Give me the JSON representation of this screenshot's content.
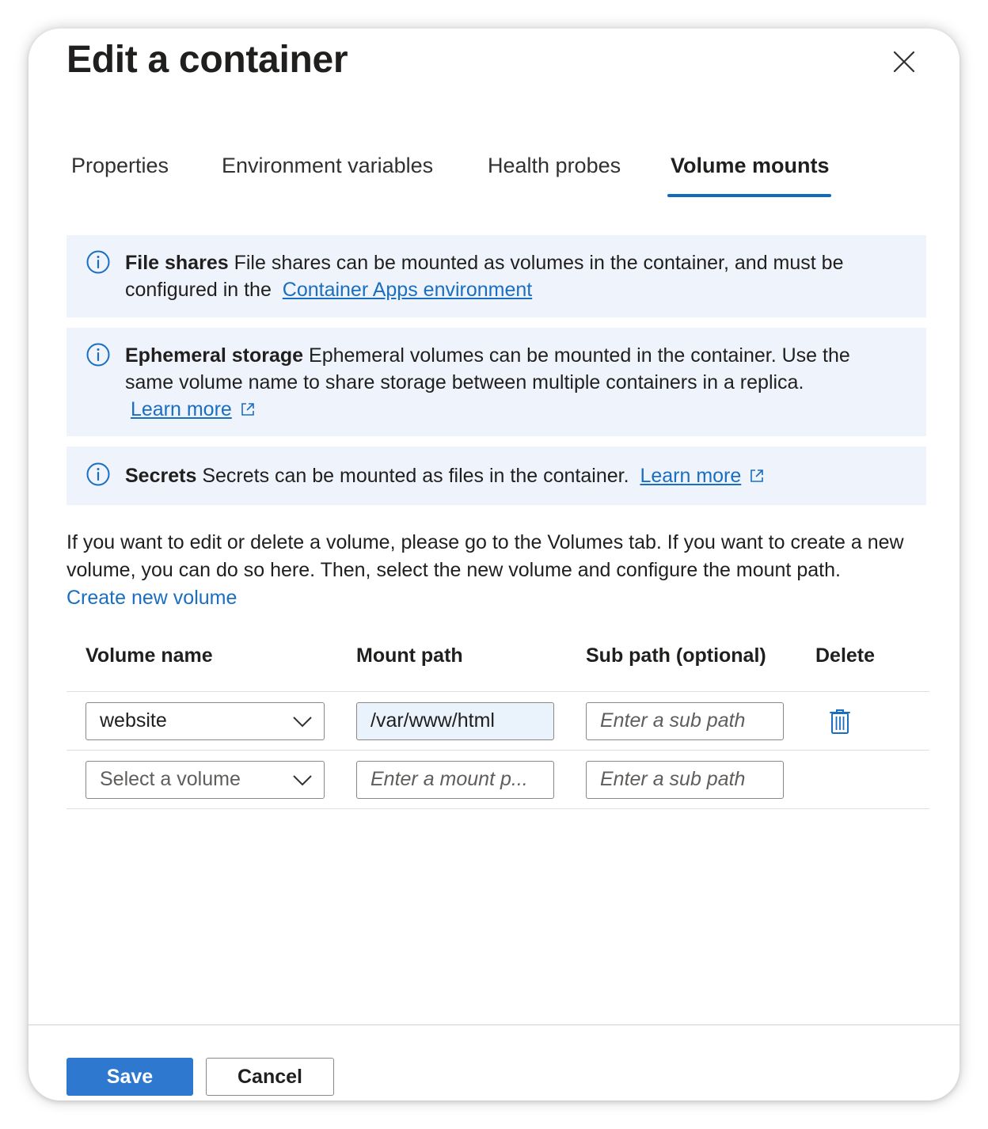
{
  "dialog": {
    "title": "Edit a container",
    "close_icon": "close-icon"
  },
  "tabs": [
    {
      "label": "Properties",
      "active": false
    },
    {
      "label": "Environment variables",
      "active": false
    },
    {
      "label": "Health probes",
      "active": false
    },
    {
      "label": "Volume mounts",
      "active": true
    }
  ],
  "info_boxes": {
    "file_shares": {
      "heading": "File shares",
      "text": "File shares can be mounted as volumes in the container, and must be configured in the",
      "link": "Container Apps environment"
    },
    "ephemeral": {
      "heading": "Ephemeral storage",
      "text": "Ephemeral volumes can be mounted in the container. Use the same volume name to share storage between multiple containers in a replica.",
      "link": "Learn more"
    },
    "secrets": {
      "heading": "Secrets",
      "text": "Secrets can be mounted as files in the container.",
      "link": "Learn more"
    }
  },
  "description": "If you want to edit or delete a volume, please go to the Volumes tab. If you want to create a new volume, you can do so here. Then, select the new volume and configure the mount path.",
  "create_new_volume": "Create new volume",
  "table": {
    "headers": {
      "volume_name": "Volume name",
      "mount_path": "Mount path",
      "sub_path": "Sub path (optional)",
      "delete": "Delete"
    },
    "rows": [
      {
        "volume": "website",
        "mount_path": "/var/www/html",
        "sub_path_placeholder": "Enter a sub path"
      },
      {
        "volume_placeholder": "Select a volume",
        "mount_path_placeholder": "Enter a mount p...",
        "sub_path_placeholder": "Enter a sub path"
      }
    ]
  },
  "footer": {
    "save": "Save",
    "cancel": "Cancel"
  },
  "colors": {
    "accent": "#0f6cbd",
    "link": "#1a6ec1",
    "info_bg": "#eff4fc",
    "primary_button": "#2f78d0"
  }
}
